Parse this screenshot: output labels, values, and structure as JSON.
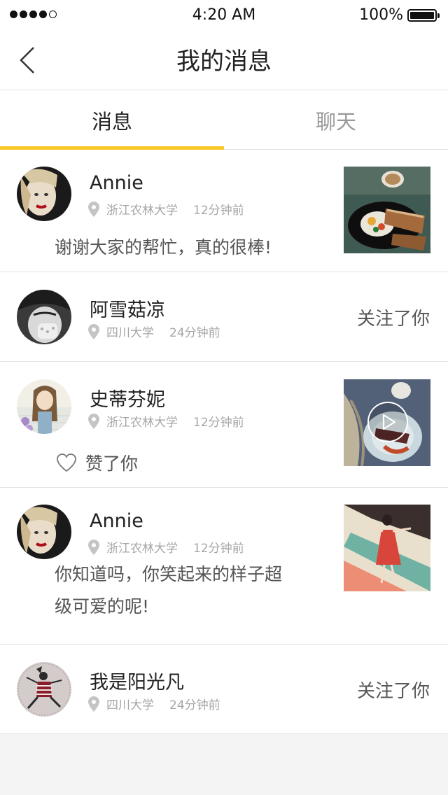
{
  "status_bar": {
    "time": "4:20 AM",
    "battery_text": "100%"
  },
  "nav": {
    "title": "我的消息",
    "back_icon": "chevron-left-icon"
  },
  "tabs": [
    {
      "label": "消息",
      "active": true
    },
    {
      "label": "聊天",
      "active": false
    }
  ],
  "accent_color": "#f8c828",
  "messages": [
    {
      "name": "Annie",
      "location": "浙江农林大学",
      "time": "12分钟前",
      "text": "谢谢大家的帮忙，真的很棒!"
    },
    {
      "name": "阿雪菇凉",
      "location": "四川大学",
      "time": "24分钟前",
      "action": "关注了你"
    },
    {
      "name": "史蒂芬妮",
      "location": "浙江农林大学",
      "time": "12分钟前",
      "action": "赞了你"
    },
    {
      "name": "Annie",
      "location": "浙江农林大学",
      "time": "12分钟前",
      "text_line1": "你知道吗，你笑起来的样子超",
      "text_line2": "级可爱的呢!"
    },
    {
      "name": "我是阳光凡",
      "location": "四川大学",
      "time": "24分钟前",
      "action": "关注了你"
    }
  ]
}
